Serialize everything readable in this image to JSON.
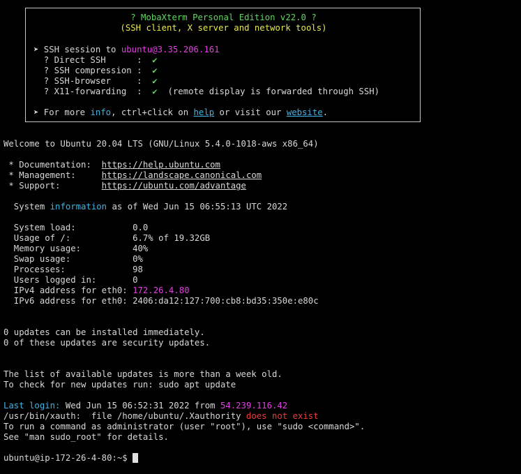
{
  "banner": {
    "title": "? MobaXterm Personal Edition v22.0 ?",
    "subtitle": "(SSH client, X server and network tools)",
    "ssh_prefix": "➤ SSH session to ",
    "ssh_target": "ubuntu@3.35.206.161",
    "features": [
      {
        "label": "  ? Direct SSH      :  ",
        "mark": "✔",
        "note": ""
      },
      {
        "label": "  ? SSH compression :  ",
        "mark": "✔",
        "note": ""
      },
      {
        "label": "  ? SSH-browser     :  ",
        "mark": "✔",
        "note": ""
      },
      {
        "label": "  ? X11-forwarding  :  ",
        "mark": "✔",
        "note": "  (remote display is forwarded through SSH)"
      }
    ],
    "more_prefix": "➤ For more ",
    "more_info": "info",
    "more_mid": ", ctrl+click on ",
    "more_help": "help",
    "more_mid2": " or visit our ",
    "more_website": "website",
    "more_end": "."
  },
  "welcome": "Welcome to Ubuntu 20.04 LTS (GNU/Linux 5.4.0-1018-aws x86_64)",
  "links": [
    {
      "label": " * Documentation:  ",
      "url": "https://help.ubuntu.com"
    },
    {
      "label": " * Management:     ",
      "url": "https://landscape.canonical.com"
    },
    {
      "label": " * Support:        ",
      "url": "https://ubuntu.com/advantage"
    }
  ],
  "sysinfo": {
    "prefix": "  System ",
    "word": "information",
    "suffix": " as of Wed Jun 15 06:55:13 UTC 2022"
  },
  "stats": [
    {
      "label": "  System load:           ",
      "value": "0.0"
    },
    {
      "label": "  Usage of /:            ",
      "value": "6.7% of 19.32GB"
    },
    {
      "label": "  Memory usage:          ",
      "value": "40%"
    },
    {
      "label": "  Swap usage:            ",
      "value": "0%"
    },
    {
      "label": "  Processes:             ",
      "value": "98"
    },
    {
      "label": "  Users logged in:       ",
      "value": "0"
    },
    {
      "label": "  IPv4 address for eth0: ",
      "value": "172.26.4.80"
    },
    {
      "label": "  IPv6 address for eth0: ",
      "value": "2406:da12:127:700:cb8:bd35:350e:e80c"
    }
  ],
  "updates": [
    "0 updates can be installed immediately.",
    "0 of these updates are security updates."
  ],
  "list_notice": [
    "The list of available updates is more than a week old.",
    "To check for new updates run: sudo apt update"
  ],
  "last_login": {
    "label": "Last login:",
    "mid": " Wed Jun 15 06:52:31 2022 from ",
    "ip": "54.239.116.42"
  },
  "xauth": {
    "prefix": "/usr/bin/xauth:  file /home/ubuntu/.Xauthority ",
    "error": "does not exist"
  },
  "sudo_lines": [
    "To run a command as administrator (user \"root\"), use \"sudo <command>\".",
    "See \"man sudo_root\" for details."
  ],
  "prompt": "ubuntu@ip-172-26-4-80:~$ ",
  "colors": {
    "background": "#000000",
    "text": "#d8d8d8",
    "title": "#5fd75f",
    "subtitle": "#e8e84d",
    "highlight": "#e23ee2",
    "info": "#3fb4e6",
    "error": "#ef3c3c"
  }
}
